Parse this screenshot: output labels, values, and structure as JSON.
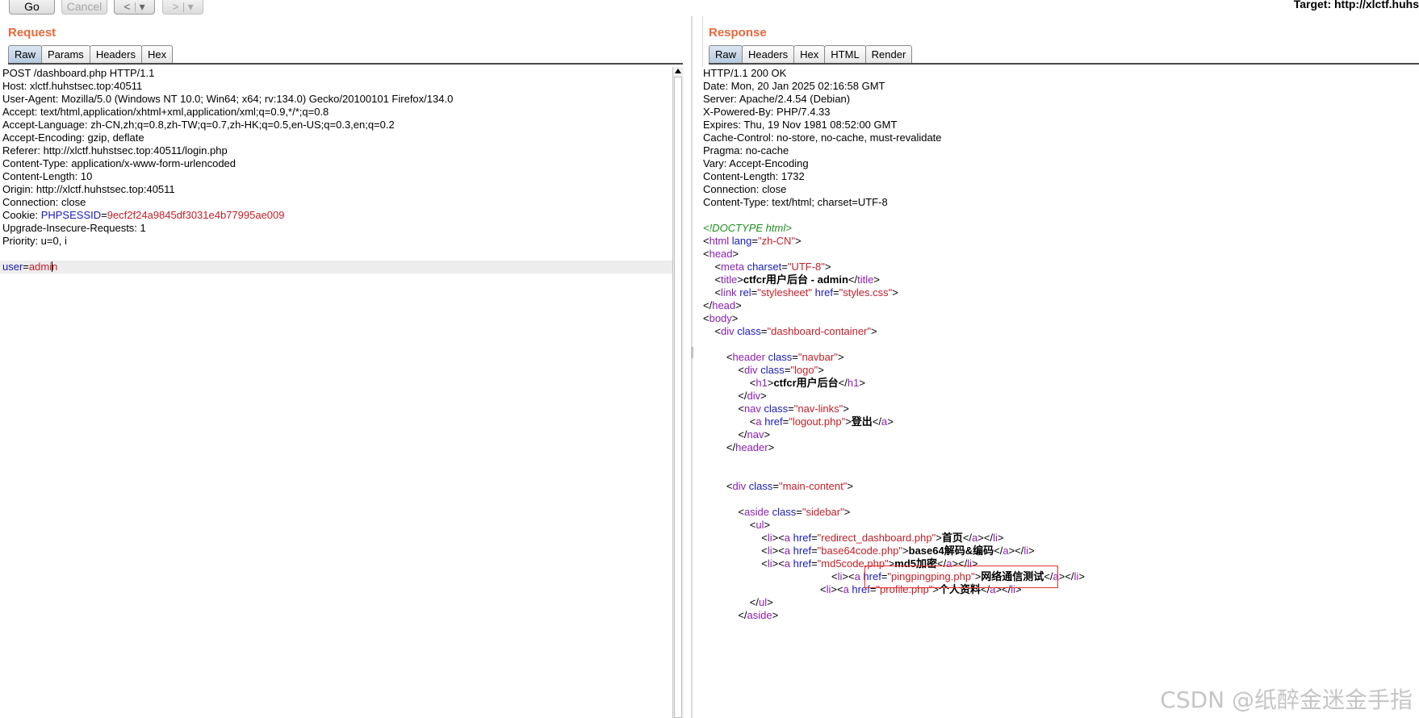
{
  "toolbar": {
    "go_label": "Go",
    "cancel_label": "Cancel",
    "back_label": "<",
    "back_menu_label": "▾",
    "forward_label": ">",
    "forward_menu_label": "▾",
    "target_label": "Target: http://xlctf.huhs"
  },
  "request": {
    "title": "Request",
    "tabs": [
      "Raw",
      "Params",
      "Headers",
      "Hex"
    ],
    "lines": {
      "l1": "POST /dashboard.php HTTP/1.1",
      "l2": "Host: xlctf.huhstsec.top:40511",
      "l3": "User-Agent: Mozilla/5.0 (Windows NT 10.0; Win64; x64; rv:134.0) Gecko/20100101 Firefox/134.0",
      "l4": "Accept: text/html,application/xhtml+xml,application/xml;q=0.9,*/*;q=0.8",
      "l5": "Accept-Language: zh-CN,zh;q=0.8,zh-TW;q=0.7,zh-HK;q=0.5,en-US;q=0.3,en;q=0.2",
      "l6": "Accept-Encoding: gzip, deflate",
      "l7": "Referer: http://xlctf.huhstsec.top:40511/login.php",
      "l8": "Content-Type: application/x-www-form-urlencoded",
      "l9": "Content-Length: 10",
      "l10": "Origin: http://xlctf.huhstsec.top:40511",
      "l11": "Connection: close",
      "cookie_prefix": "Cookie: ",
      "cookie_name": "PHPSESSID",
      "cookie_eq": "=",
      "cookie_value": "9ecf2f24a9845df3031e4b77995ae009",
      "l13": "Upgrade-Insecure-Requests: 1",
      "l14": "Priority: u=0, i",
      "body_key": "user",
      "body_eq": "=",
      "body_val_a": "admi",
      "body_val_b": "n"
    }
  },
  "response": {
    "title": "Response",
    "tabs": [
      "Raw",
      "Headers",
      "Hex",
      "HTML",
      "Render"
    ],
    "headers": {
      "h1": "HTTP/1.1 200 OK",
      "h2": "Date: Mon, 20 Jan 2025 02:16:58 GMT",
      "h3": "Server: Apache/2.4.54 (Debian)",
      "h4": "X-Powered-By: PHP/7.4.33",
      "h5": "Expires: Thu, 19 Nov 1981 08:52:00 GMT",
      "h6": "Cache-Control: no-store, no-cache, must-revalidate",
      "h7": "Pragma: no-cache",
      "h8": "Vary: Accept-Encoding",
      "h9": "Content-Length: 1732",
      "h10": "Connection: close",
      "h11": "Content-Type: text/html; charset=UTF-8"
    },
    "html": {
      "doctype": "<!DOCTYPE html>",
      "title_text": "ctfcr用户后台 - admin",
      "h1_text": "ctfcr用户后台",
      "logout_text": "登出",
      "nav1_text": "首页",
      "nav2_text": "base64解码&编码",
      "nav3_text": "md5加密",
      "nav4_text": "网络通信测试",
      "nav5_text": "个人资料"
    }
  },
  "watermark": "CSDN @纸醉金迷金手指",
  "colors": {
    "panel_title": "#e8693c",
    "header_name": "#1a1ab8",
    "header_value": "#c0202a",
    "tag": "#8b1fb0",
    "comment": "#1d8f1d",
    "highlight_box": "#e03030"
  }
}
